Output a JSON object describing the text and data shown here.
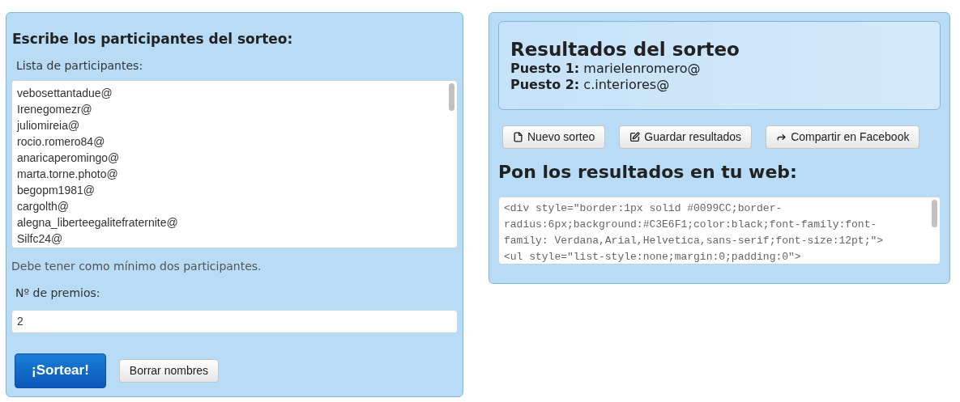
{
  "entry_panel": {
    "heading": "Escribe los participantes del sorteo:",
    "list_label": "Lista de participantes:",
    "participants": [
      "vebosettantadue@",
      "Irenegomezr@",
      "juliomireia@",
      "rocio.romero84@",
      "anaricaperomingo@",
      "marta.torne.photo@",
      "begopm1981@",
      "cargolth@",
      "alegna_liberteegalitefraternite@",
      "Silfc24@"
    ],
    "hint": "Debe tener como mínimo dos participantes.",
    "prizes_label": "Nº de premios:",
    "prizes_value": "2",
    "buttons": [
      {
        "kind": "primary",
        "label": "¡Sortear!"
      },
      {
        "kind": "default",
        "label": "Borrar nombres"
      }
    ]
  },
  "results_panel": {
    "title": "Resultados del sorteo",
    "places": [
      {
        "label": "Puesto 1:",
        "winner": "marielenromero@"
      },
      {
        "label": "Puesto 2:",
        "winner": "c.interiores@"
      }
    ],
    "buttons": [
      {
        "kind": "new",
        "label": "Nuevo sorteo"
      },
      {
        "kind": "save",
        "label": "Guardar resultados"
      },
      {
        "kind": "share",
        "label": "Compartir en Facebook"
      }
    ],
    "embed_heading": "Pon los resultados en tu web:",
    "embed_code": [
      "<div style=\"border:1px solid #0099CC;border-",
      "radius:6px;background:#C3E6F1;color:black;font-family:font-",
      "family: Verdana,Arial,Helvetica,sans-serif;font-size:12pt;\">",
      "<ul style=\"list-style:none;margin:0;padding:0\">"
    ]
  }
}
